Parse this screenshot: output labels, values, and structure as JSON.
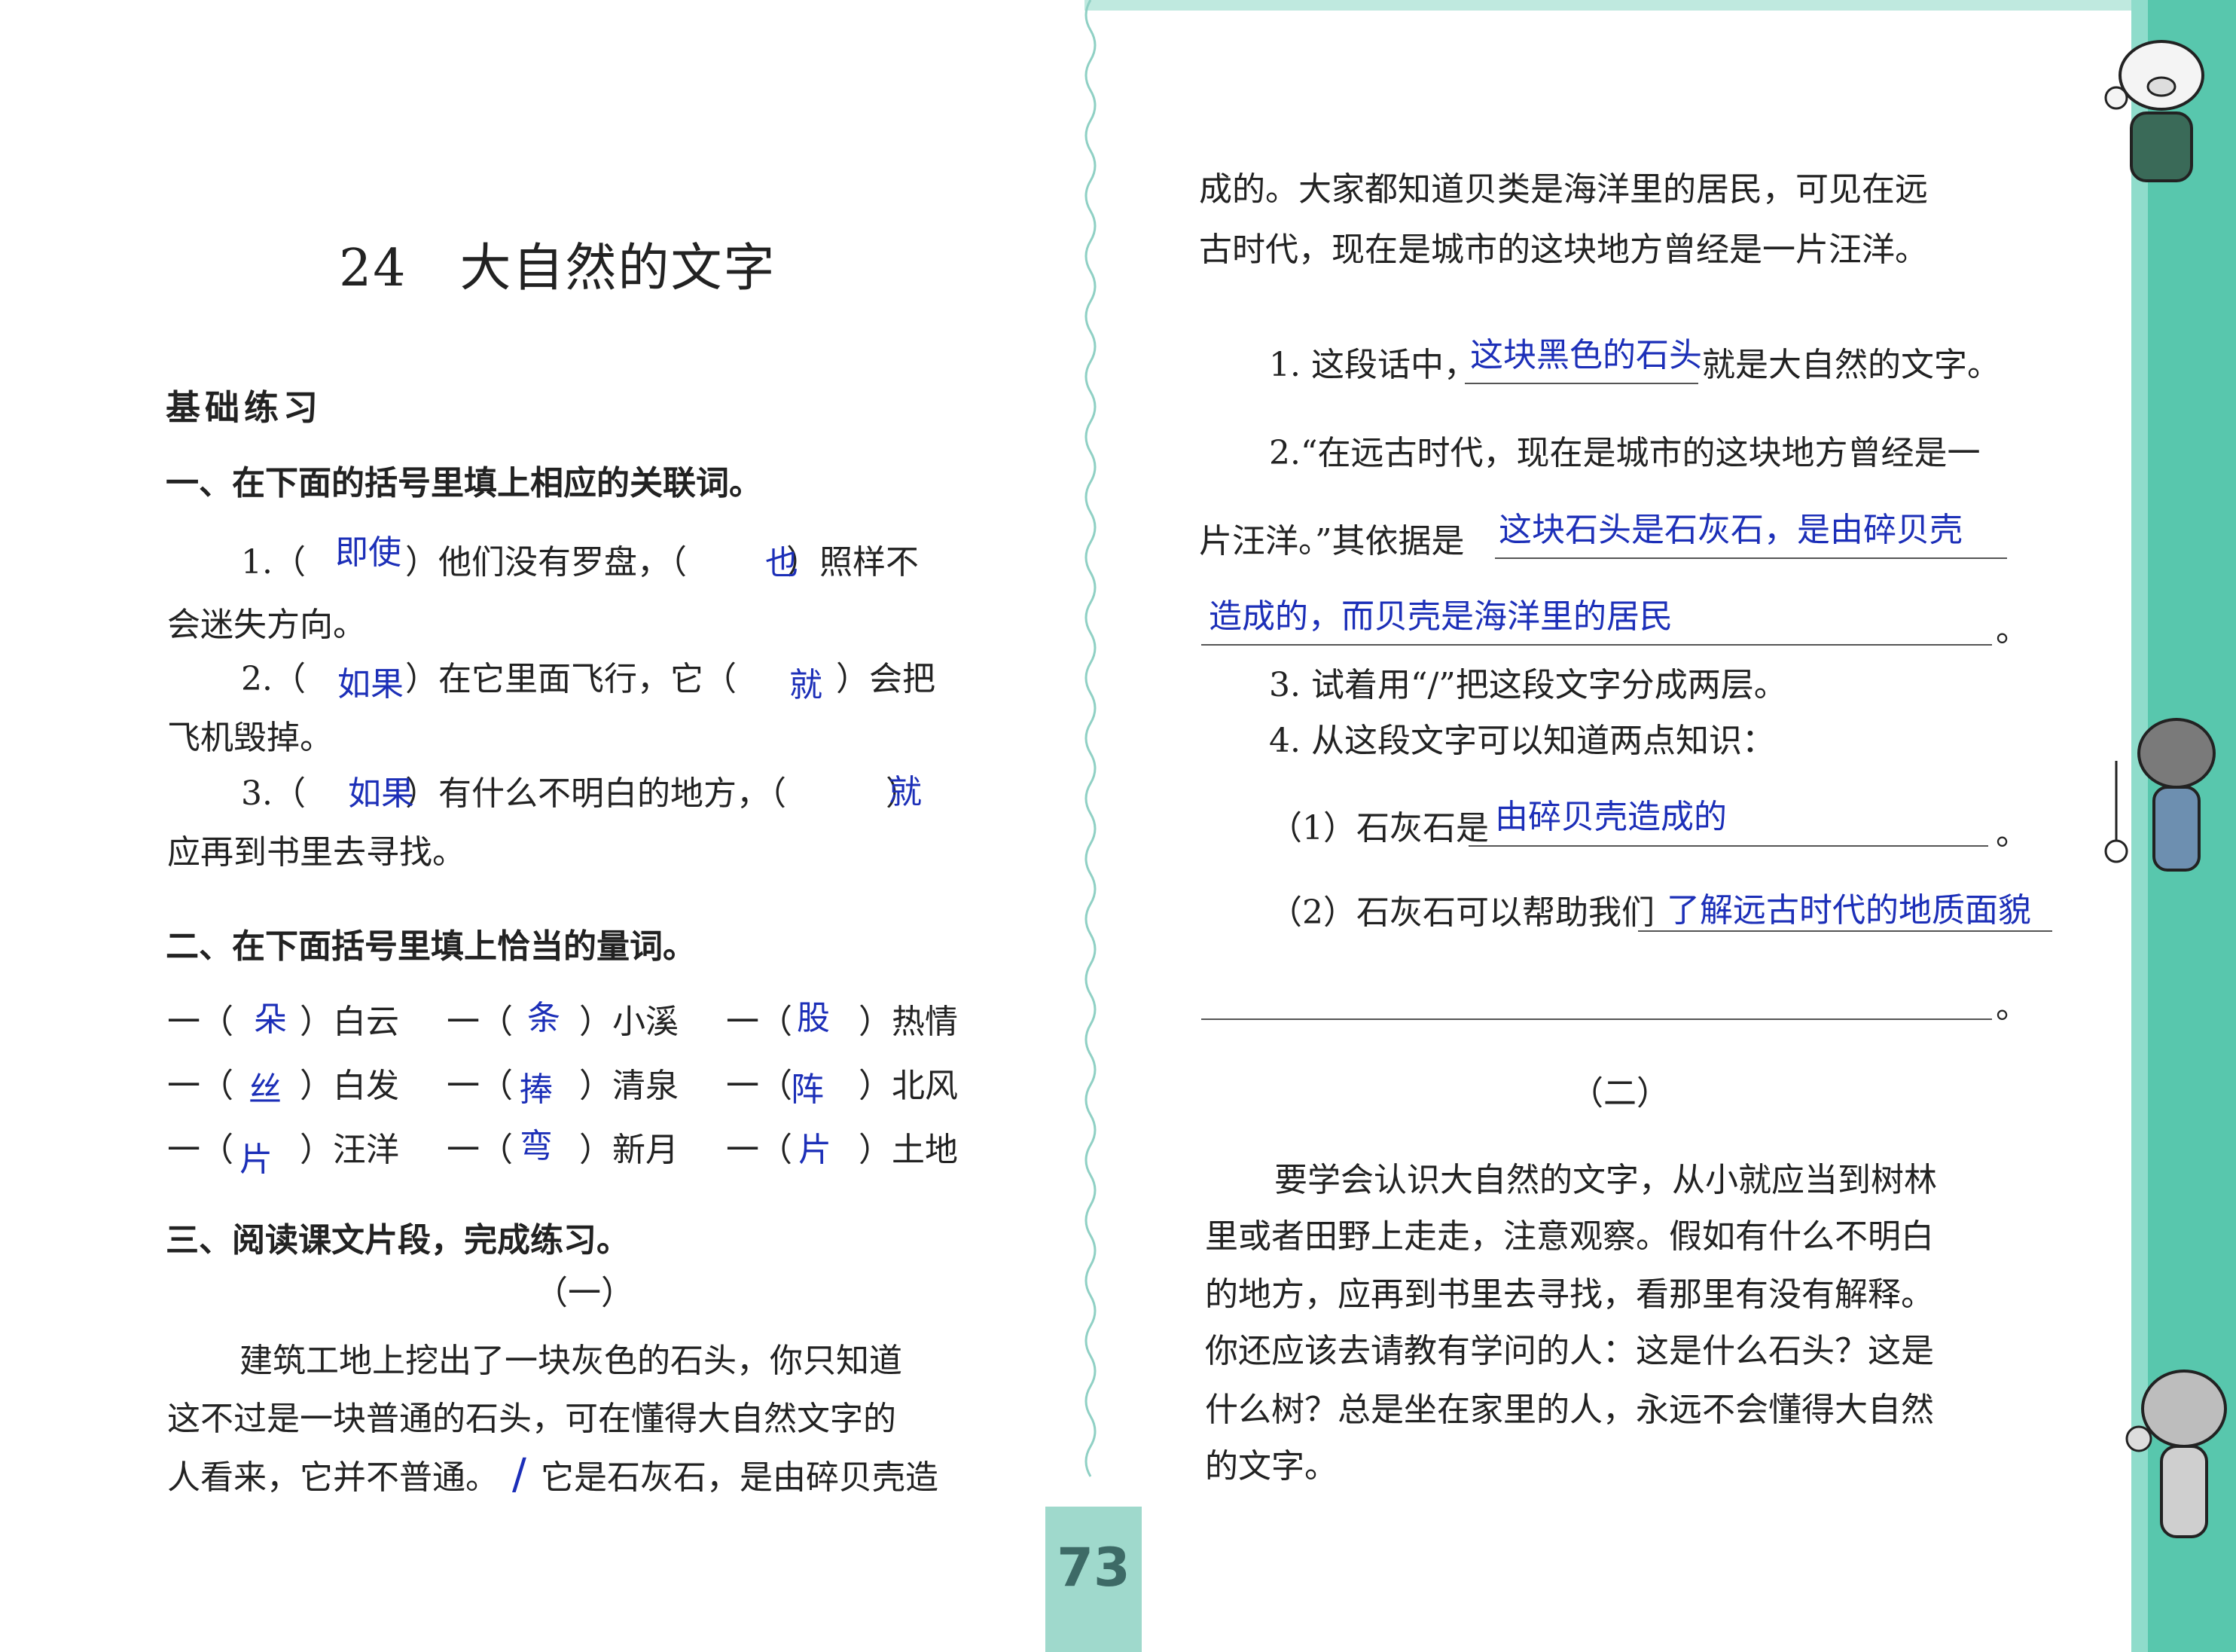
{
  "page_number": "73",
  "lesson_title": {
    "number": "24",
    "text": "大自然的文字"
  },
  "basic_practice": "基础练习",
  "section1": {
    "heading": "一、在下面的括号里填上相应的关联词。",
    "q1": {
      "line1": "1.（　　　）他们没有罗盘，（　　　）照样不",
      "line2": "会迷失方向。",
      "ans1": "即使",
      "ans2": "也"
    },
    "q2": {
      "line1": "2.（　　　）在它里面飞行，它（　　　）会把",
      "line2": "飞机毁掉。",
      "ans1": "如果",
      "ans2": "就"
    },
    "q3": {
      "line1": "3.（　　　）有什么不明白的地方，（　　　）",
      "line2": "应再到书里去寻找。",
      "ans1": "如果",
      "ans2": "就"
    }
  },
  "section2": {
    "heading": "二、在下面括号里填上恰当的量词。",
    "rows": [
      {
        "c1": "一（　　）白云",
        "a1": "朵",
        "c2": "一（　　）小溪",
        "a2": "条",
        "c3": "一（　　）热情",
        "a3": "股"
      },
      {
        "c1": "一（　　）白发",
        "a1": "丝",
        "c2": "一（　　）清泉",
        "a2": "捧",
        "c3": "一（　　）北风",
        "a3": "阵"
      },
      {
        "c1": "一（　　）汪洋",
        "a1": "片",
        "c2": "一（　　）新月",
        "a2": "弯",
        "c3": "一（　　）土地",
        "a3": "片"
      }
    ]
  },
  "section3": {
    "heading": "三、阅读课文片段，完成练习。",
    "part1_label": "（一）",
    "passage": [
      "建筑工地上挖出了一块灰色的石头，你只知道",
      "这不过是一块普通的石头，可在懂得大自然文字的",
      "人看来，它并不普通。",
      "它是石灰石，是由碎贝壳造"
    ],
    "slash_mark": "/"
  },
  "right": {
    "passage": [
      "成的。大家都知道贝类是海洋里的居民，可见在远",
      "古时代，现在是城市的这块地方曾经是一片汪洋。"
    ],
    "q1": {
      "prefix": "1. 这段话中，",
      "suffix": "就是大自然的文字。",
      "answer": "这块黑色的石头"
    },
    "q2": {
      "line1": "2.“在远古时代，现在是城市的这块地方曾经是一",
      "line2_prefix": "片汪洋。”其依据是",
      "answer_line1": "这块石头是石灰石，是由碎贝壳",
      "answer_line2": "造成的，而贝壳是海洋里的居民",
      "end": "。"
    },
    "q3": "3. 试着用“/”把这段文字分成两层。",
    "q4": {
      "text": "4. 从这段文字可以知道两点知识：",
      "sub1_prefix": "（1）石灰石是",
      "sub1_answer": "由碎贝壳造成的",
      "sub1_end": "。",
      "sub2_prefix": "（2）石灰石可以帮助我们",
      "sub2_answer": "了解远古时代的地质面貌",
      "sub2_end": "。"
    },
    "part2_label": "（二）",
    "passage2": [
      "要学会认识大自然的文字，从小就应当到树林",
      "里或者田野上走走，注意观察。假如有什么不明白",
      "的地方，应再到书里去寻找，看那里有没有解释。",
      "你还应该去请教有学问的人：这是什么石头？这是",
      "什么树？总是坐在家里的人，永远不会懂得大自然",
      "的文字。"
    ]
  }
}
